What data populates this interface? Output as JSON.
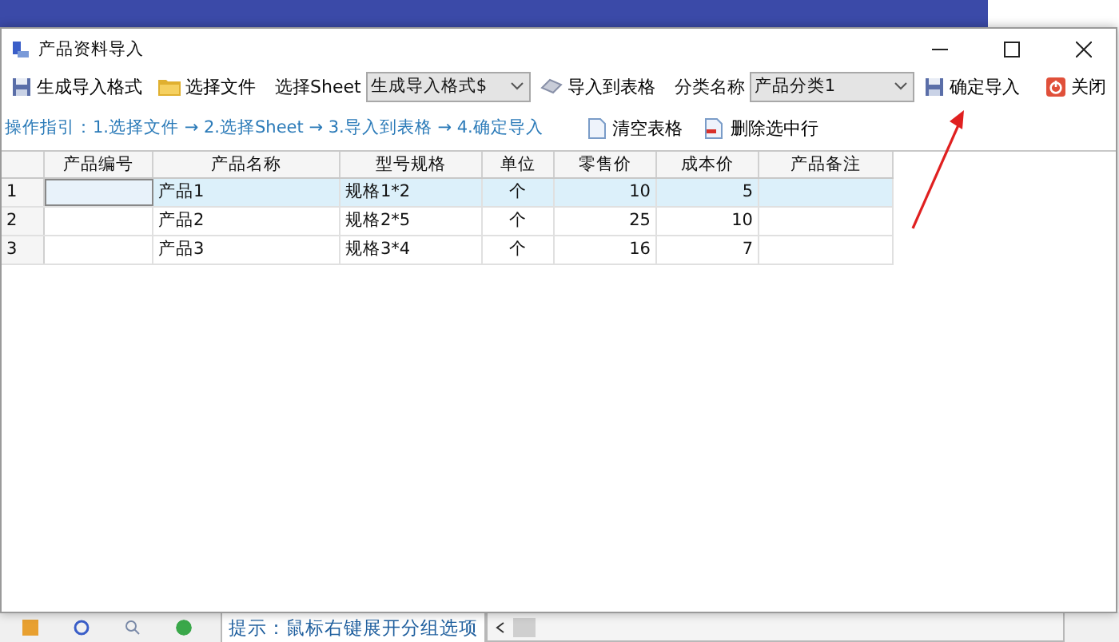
{
  "window": {
    "title": "产品资料导入"
  },
  "toolbar": [
    {
      "kind": "button",
      "label": "生成导入格式"
    },
    {
      "kind": "button",
      "label": "选择文件"
    },
    {
      "kind": "label",
      "label": "选择Sheet"
    },
    {
      "kind": "dropdown",
      "value": "生成导入格式$"
    },
    {
      "kind": "button",
      "label": "导入到表格"
    },
    {
      "kind": "label",
      "label": "分类名称"
    },
    {
      "kind": "dropdown",
      "value": "产品分类1"
    },
    {
      "kind": "button",
      "label": "确定导入"
    },
    {
      "kind": "button",
      "label": "关闭"
    }
  ],
  "guide": "操作指引：1.选择文件 → 2.选择Sheet → 3.导入到表格 → 4.确定导入",
  "actions": [
    {
      "label": "清空表格"
    },
    {
      "label": "删除选中行"
    }
  ],
  "table": {
    "columns": [
      "产品编号",
      "产品名称",
      "型号规格",
      "单位",
      "零售价",
      "成本价",
      "产品备注"
    ],
    "rows": [
      {
        "number": "1",
        "selected": true,
        "cells": [
          "",
          "产品1",
          "规格1*2",
          "个",
          "10",
          "5",
          ""
        ]
      },
      {
        "number": "2",
        "selected": false,
        "cells": [
          "",
          "产品2",
          "规格2*5",
          "个",
          "25",
          "10",
          ""
        ]
      },
      {
        "number": "3",
        "selected": false,
        "cells": [
          "",
          "产品3",
          "规格3*4",
          "个",
          "16",
          "7",
          ""
        ]
      }
    ]
  },
  "background_app": {
    "hint": "提示：鼠标右键展开分组选项"
  }
}
